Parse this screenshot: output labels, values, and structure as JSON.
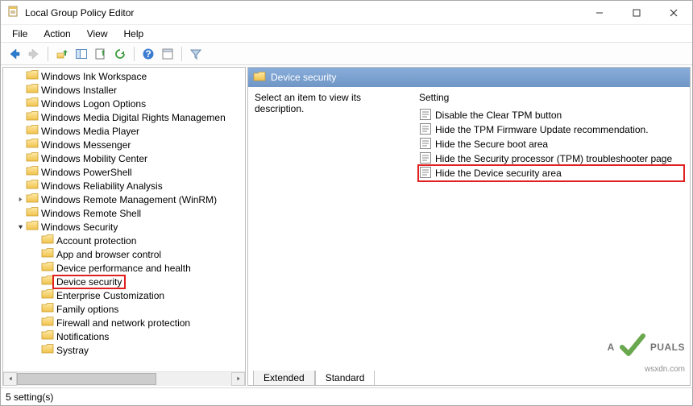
{
  "window": {
    "title": "Local Group Policy Editor"
  },
  "menu": {
    "items": [
      "File",
      "Action",
      "View",
      "Help"
    ]
  },
  "tree": {
    "top": [
      {
        "label": "Windows Ink Workspace",
        "indent": 28,
        "exp": ""
      },
      {
        "label": "Windows Installer",
        "indent": 28,
        "exp": ""
      },
      {
        "label": "Windows Logon Options",
        "indent": 28,
        "exp": ""
      },
      {
        "label": "Windows Media Digital Rights Managemen",
        "indent": 28,
        "exp": ""
      },
      {
        "label": "Windows Media Player",
        "indent": 28,
        "exp": ""
      },
      {
        "label": "Windows Messenger",
        "indent": 28,
        "exp": ""
      },
      {
        "label": "Windows Mobility Center",
        "indent": 28,
        "exp": ""
      },
      {
        "label": "Windows PowerShell",
        "indent": 28,
        "exp": ""
      },
      {
        "label": "Windows Reliability Analysis",
        "indent": 28,
        "exp": ""
      },
      {
        "label": "Windows Remote Management (WinRM)",
        "indent": 28,
        "exp": "closed"
      },
      {
        "label": "Windows Remote Shell",
        "indent": 28,
        "exp": ""
      },
      {
        "label": "Windows Security",
        "indent": 28,
        "exp": "open"
      }
    ],
    "children": [
      {
        "label": "Account protection"
      },
      {
        "label": "App and browser control"
      },
      {
        "label": "Device performance and health"
      },
      {
        "label": "Device security",
        "selected": true
      },
      {
        "label": "Enterprise Customization"
      },
      {
        "label": "Family options"
      },
      {
        "label": "Firewall and network protection"
      },
      {
        "label": "Notifications"
      },
      {
        "label": "Systray"
      }
    ]
  },
  "content": {
    "header_title": "Device security",
    "description_prompt": "Select an item to view its description.",
    "setting_column": "Setting",
    "settings": [
      {
        "label": "Disable the Clear TPM button"
      },
      {
        "label": "Hide the TPM Firmware Update recommendation."
      },
      {
        "label": "Hide the Secure boot area"
      },
      {
        "label": "Hide the Security processor (TPM) troubleshooter page"
      },
      {
        "label": "Hide the Device security area",
        "highlighted": true
      }
    ],
    "tabs": {
      "extended": "Extended",
      "standard": "Standard"
    }
  },
  "status": {
    "text": "5 setting(s)"
  },
  "watermark": {
    "brand_a": "A",
    "brand_b": "PUALS",
    "domain": "wsxdn.com"
  }
}
